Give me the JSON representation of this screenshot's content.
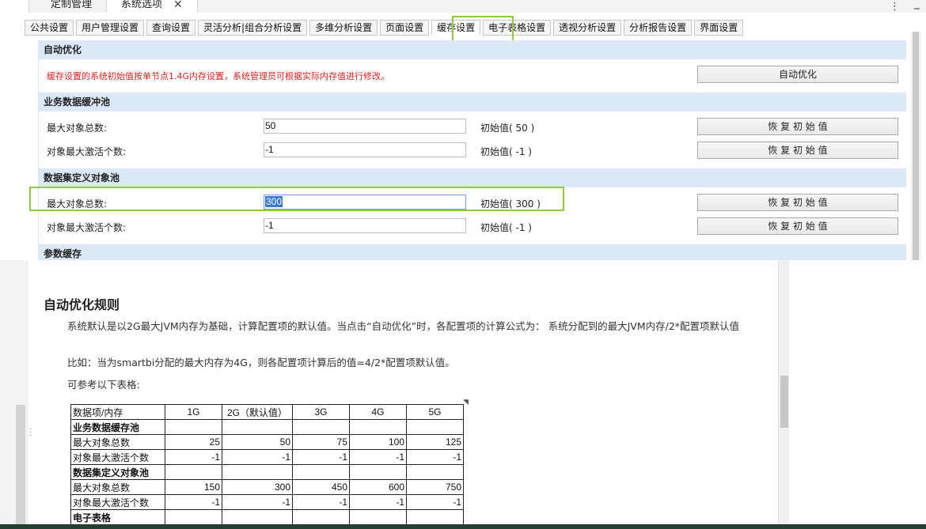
{
  "app": {
    "doc_tabs": [
      {
        "label": "定制管理"
      },
      {
        "label": "系统选项"
      }
    ],
    "close_symbol": "✕",
    "menu_symbol": "⋮",
    "section_tabs": [
      {
        "label": "公共设置"
      },
      {
        "label": "用户管理设置"
      },
      {
        "label": "查询设置"
      },
      {
        "label": "灵活分析|组合分析设置"
      },
      {
        "label": "多维分析设置"
      },
      {
        "label": "页面设置"
      },
      {
        "label": "缓存设置"
      },
      {
        "label": "电子表格设置"
      },
      {
        "label": "透视分析设置"
      },
      {
        "label": "分析报告设置"
      },
      {
        "label": "界面设置"
      }
    ],
    "active_tab": "缓存设置",
    "auto_opt": {
      "header": "自动优化",
      "note": "缓存设置的系统初始值按单节点1.4G内存设置，系统管理员可根据实际内存值进行修改。",
      "button": "自动优化"
    },
    "business_pool": {
      "header": "业务数据缓冲池",
      "rows": [
        {
          "label": "最大对象总数:",
          "value": "50",
          "init": "初始值( 50 )",
          "button": "恢 复 初 始 值"
        },
        {
          "label": "对象最大激活个数:",
          "value": "-1",
          "init": "初始值( -1 )",
          "button": "恢 复 初 始 值"
        }
      ]
    },
    "dataset_pool": {
      "header": "数据集定义对象池",
      "rows": [
        {
          "label": "最大对象总数:",
          "value": "300",
          "init": "初始值( 300 )",
          "button": "恢 复 初 始 值"
        },
        {
          "label": "对象最大激活个数:",
          "value": "-1",
          "init": "初始值( -1 )",
          "button": "恢 复 初 始 值"
        }
      ]
    },
    "param_cache": {
      "header": "参数缓存"
    }
  },
  "doc": {
    "title": "自动优化规则",
    "para1": "系统默认是以2G最大JVM内存为基础，计算配置项的默认值。当点击“自动优化”时，各配置项的计算公式为： 系统分配到的最大JVM内存/2*配置项默认值",
    "para2": "比如：当为smartbi分配的最大内存为4G，则各配置项计算后的值=4/2*配置项默认值。",
    "para3": "可参考以下表格:",
    "table": {
      "header": [
        "数据项/内存",
        "1G",
        "2G（默认值）",
        "3G",
        "4G",
        "5G"
      ],
      "rows": [
        {
          "group": true,
          "cells": [
            "业务数据缓存池",
            "",
            "",
            "",
            "",
            ""
          ]
        },
        {
          "group": false,
          "cells": [
            "最大对象总数",
            "25",
            "50",
            "75",
            "100",
            "125"
          ]
        },
        {
          "group": false,
          "cells": [
            "对象最大激活个数",
            "-1",
            "-1",
            "-1",
            "-1",
            "-1"
          ]
        },
        {
          "group": true,
          "cells": [
            "数据集定义对象池",
            "",
            "",
            "",
            "",
            ""
          ]
        },
        {
          "group": false,
          "cells": [
            "最大对象总数",
            "150",
            "300",
            "450",
            "600",
            "750"
          ]
        },
        {
          "group": false,
          "cells": [
            "对象最大激活个数",
            "-1",
            "-1",
            "-1",
            "-1",
            "-1"
          ]
        },
        {
          "group": true,
          "cells": [
            "电子表格",
            "",
            "",
            "",
            "",
            ""
          ]
        }
      ]
    }
  },
  "colors": {
    "highlight": "#92c83e",
    "section_header_bg": "#dbe8f5",
    "note_red": "#e02020",
    "selection_blue": "#3a79d8"
  }
}
